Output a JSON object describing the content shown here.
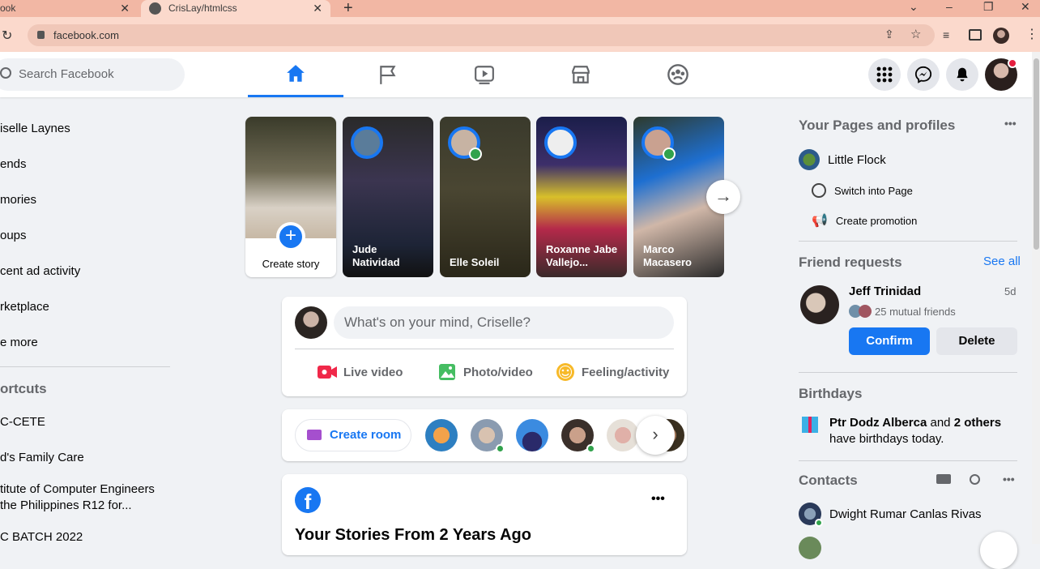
{
  "browser": {
    "tab1_label": "ook",
    "tab2_label": "CrisLay/htmlcss",
    "tab_close": "✕",
    "new_tab": "+",
    "url": "facebook.com"
  },
  "header": {
    "search_placeholder": "Search Facebook"
  },
  "left_nav": {
    "items": [
      "Criselle Laynes",
      "Friends",
      "Memories",
      "Groups",
      "Recent ad activity",
      "Marketplace",
      "See more"
    ],
    "display": [
      "iselle Laynes",
      "ends",
      "mories",
      "oups",
      "cent ad activity",
      "rketplace",
      "e more"
    ],
    "shortcuts_title": "ortcuts",
    "shortcuts": [
      "C-CETE",
      "d's Family Care",
      "titute of Computer Engineers",
      "the Philippines R12 for...",
      "C BATCH 2022"
    ]
  },
  "stories": {
    "create_label": "Create story",
    "items": [
      {
        "name": "Jude\nNatividad",
        "line1": "Jude",
        "line2": "Natividad"
      },
      {
        "name": "Elle Soleil",
        "line1": "Elle Soleil",
        "line2": ""
      },
      {
        "name": "Roxanne Jabe Vallejo...",
        "line1": "Roxanne Jabe",
        "line2": "Vallejo..."
      },
      {
        "name": "Marco Macasero",
        "line1": "Marco",
        "line2": "Macasero"
      }
    ]
  },
  "composer": {
    "placeholder": "What's on your mind, Criselle?",
    "live": "Live video",
    "photo": "Photo/video",
    "feeling": "Feeling/activity"
  },
  "rooms": {
    "create_room": "Create room"
  },
  "memory_post": {
    "title": "Your Stories From 2 Years Ago",
    "more": "•••"
  },
  "right": {
    "pages_title": "Your Pages and profiles",
    "page_name": "Little Flock",
    "switch": "Switch into Page",
    "promotion": "Create promotion",
    "more": "•••",
    "friend_requests_title": "Friend requests",
    "see_all": "See all",
    "request_name": "Jeff Trinidad",
    "request_time": "5d",
    "mutual": "25 mutual friends",
    "confirm": "Confirm",
    "delete": "Delete",
    "birthdays_title": "Birthdays",
    "birthday_name": "Ptr Dodz Alberca",
    "birthday_mid": " and ",
    "birthday_others": "2 others",
    "birthday_tail": "have birthdays today.",
    "contacts_title": "Contacts",
    "contact1": "Dwight Rumar Canlas Rivas"
  },
  "colors": {
    "accent": "#1877f2",
    "online": "#31a24c",
    "tab_bar": "#f2b7a4",
    "page_bg": "#f0f2f5"
  }
}
